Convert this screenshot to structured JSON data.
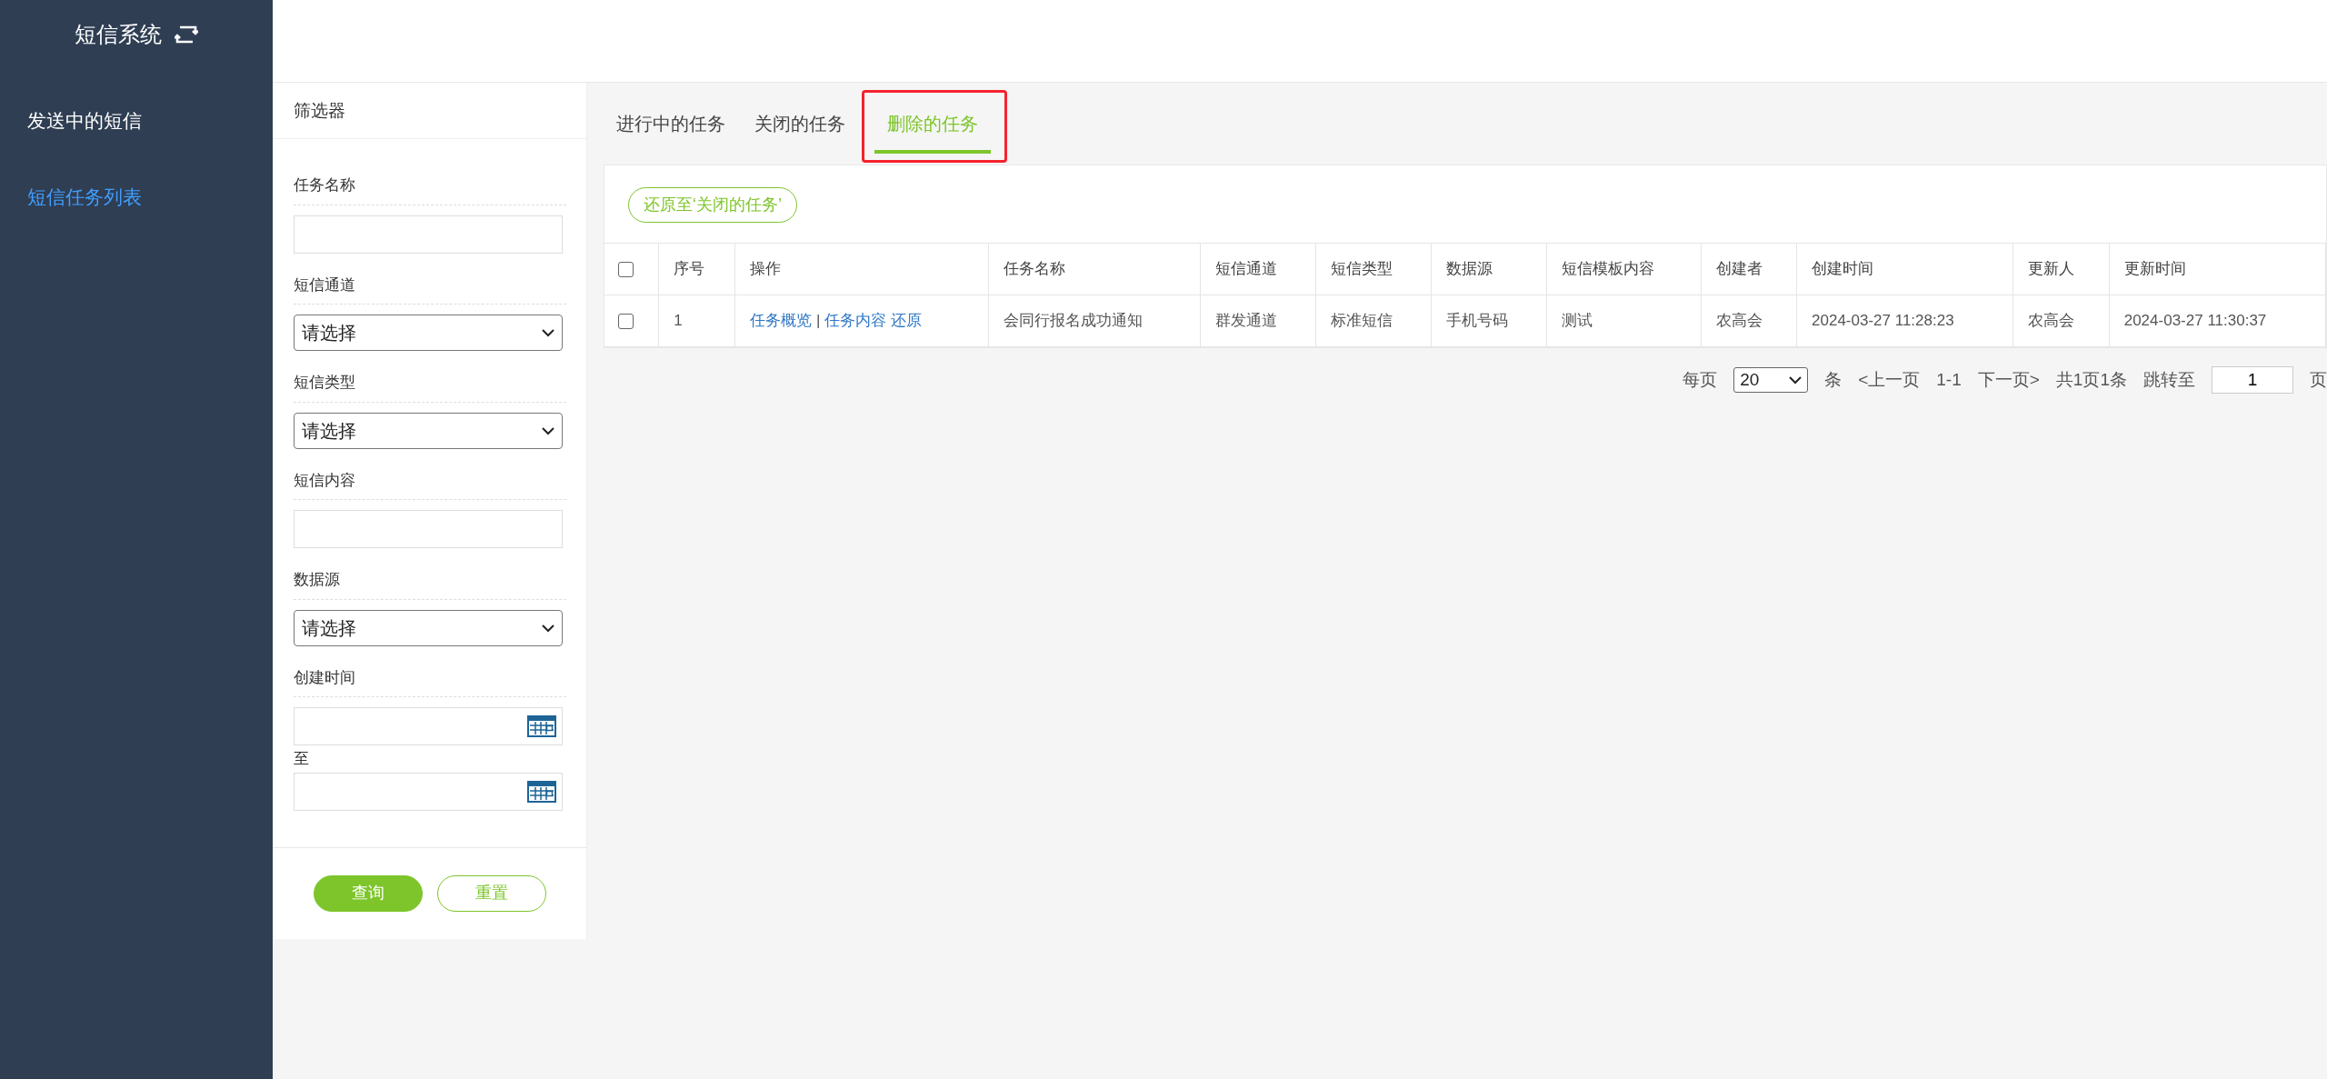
{
  "sidebar": {
    "title": "短信系统",
    "items": [
      {
        "label": "发送中的短信",
        "selected": false
      },
      {
        "label": "短信任务列表",
        "selected": true
      }
    ]
  },
  "filter": {
    "title": "筛选器",
    "fields": [
      {
        "kind": "text",
        "label": "任务名称"
      },
      {
        "kind": "select",
        "label": "短信通道",
        "value": "请选择"
      },
      {
        "kind": "select",
        "label": "短信类型",
        "value": "请选择"
      },
      {
        "kind": "text",
        "label": "短信内容"
      },
      {
        "kind": "select",
        "label": "数据源",
        "value": "请选择"
      },
      {
        "kind": "daterange",
        "label": "创建时间",
        "separator": "至"
      }
    ],
    "buttons": [
      {
        "kind": "primary",
        "label": "查询"
      },
      {
        "kind": "outline",
        "label": "重置"
      }
    ]
  },
  "tabs": [
    {
      "label": "进行中的任务",
      "selected": false,
      "highlighted": false
    },
    {
      "label": "关闭的任务",
      "selected": false,
      "highlighted": false
    },
    {
      "label": "删除的任务",
      "selected": true,
      "highlighted": true
    }
  ],
  "toolbar": {
    "button": "还原至‘关闭的任务’"
  },
  "table": {
    "header_checked": false,
    "columns": [
      "序号",
      "操作",
      "任务名称",
      "短信通道",
      "短信类型",
      "数据源",
      "短信模板内容",
      "创建者",
      "创建时间",
      "更新人",
      "更新时间"
    ],
    "rows": [
      {
        "checked": false,
        "cells": [
          {
            "kind": "text",
            "text": "1"
          },
          {
            "kind": "actions",
            "actions": [
              {
                "kind": "link",
                "label": "任务概览"
              },
              {
                "kind": "divider",
                "label": "|"
              },
              {
                "kind": "link",
                "label": "任务内容"
              },
              {
                "kind": "link",
                "label": "还原"
              }
            ]
          },
          {
            "kind": "text",
            "text": "会同行报名成功通知"
          },
          {
            "kind": "text",
            "text": "群发通道"
          },
          {
            "kind": "text",
            "text": "标准短信"
          },
          {
            "kind": "text",
            "text": "手机号码"
          },
          {
            "kind": "text",
            "text": "测试"
          },
          {
            "kind": "text",
            "text": "农高会"
          },
          {
            "kind": "text",
            "text": "2024-03-27 11:28:23"
          },
          {
            "kind": "text",
            "text": "农高会"
          },
          {
            "kind": "text",
            "text": "2024-03-27 11:30:37"
          }
        ]
      }
    ]
  },
  "pagination": {
    "per_page_label": "每页",
    "per_page": "20",
    "unit": "条",
    "prev": "<上一页",
    "range": "1-1",
    "next": "下一页>",
    "total": "共1页1条",
    "jump_label": "跳转至",
    "jump_value": "1",
    "page_unit": "页"
  }
}
